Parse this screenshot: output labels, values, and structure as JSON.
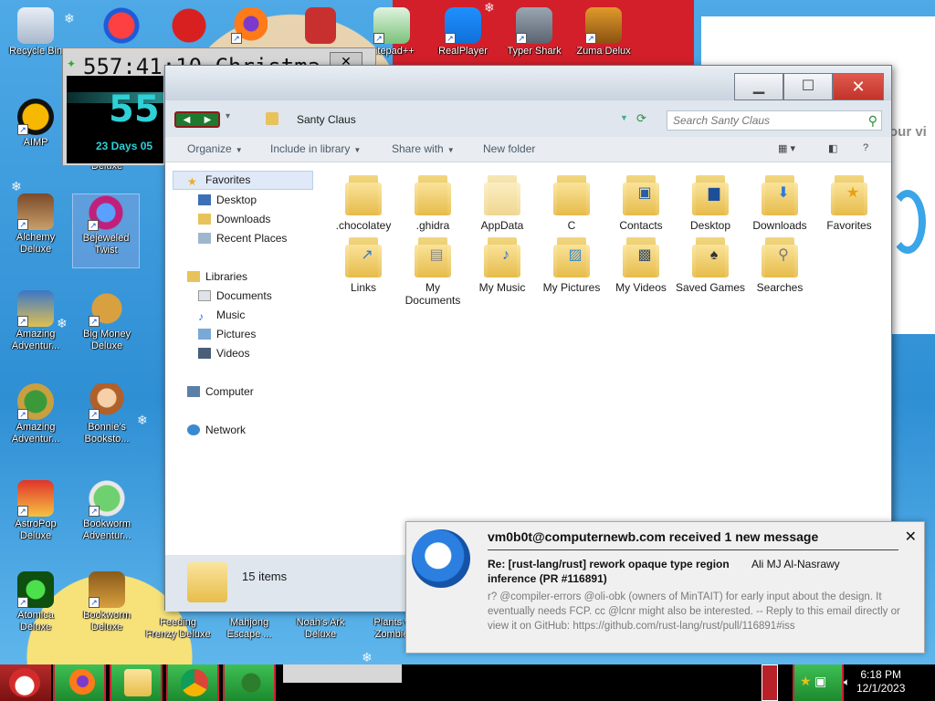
{
  "desktop": {
    "icons": [
      {
        "label": "Recycle Bin",
        "icon": "recycle-bin-icon"
      },
      {
        "label": "AIMP",
        "icon": "aimp-icon"
      },
      {
        "label": "Alchemy Deluxe",
        "icon": "alchemy-icon"
      },
      {
        "label": "Amazing Adventur...",
        "icon": "amazing-adventures-icon"
      },
      {
        "label": "Amazing Adventur...",
        "icon": "amazing-adventures-2-icon"
      },
      {
        "label": "AstroPop Deluxe",
        "icon": "astropop-icon"
      },
      {
        "label": "Atomica Deluxe",
        "icon": "atomica-icon"
      },
      {
        "label": "Deluxe",
        "icon": "app-icon"
      },
      {
        "label": "Bejeweled Twist",
        "icon": "bejeweled-icon"
      },
      {
        "label": "Big Money Deluxe",
        "icon": "big-money-icon"
      },
      {
        "label": "Bonnie's Booksto...",
        "icon": "bonnies-bookstore-icon"
      },
      {
        "label": "Bookworm Adventur...",
        "icon": "bookworm-icon"
      },
      {
        "label": "Bookworm Deluxe",
        "icon": "bookworm-deluxe-icon"
      },
      {
        "label": "Feeding Frenzy Deluxe",
        "icon": "feeding-frenzy-icon"
      },
      {
        "label": "Mahjong Escape ...",
        "icon": "mahjong-icon"
      },
      {
        "label": "Noah's Ark Deluxe",
        "icon": "noahs-ark-icon"
      },
      {
        "label": "Plants v Zombie",
        "icon": "plants-zombies-icon"
      },
      {
        "label": "Firefox",
        "icon": "firefox-icon"
      },
      {
        "label": "",
        "icon": "shrine-icon"
      },
      {
        "label": "...tepad++",
        "icon": "notepadpp-icon"
      },
      {
        "label": "RealPlayer",
        "icon": "realplayer-icon"
      },
      {
        "label": "Typer Shark",
        "icon": "typer-shark-icon"
      },
      {
        "label": "Zuma Delux",
        "icon": "zuma-icon"
      }
    ],
    "clock": {
      "countdown": "557:41:10",
      "overlay_text": "Christma",
      "big_value": "55",
      "days_text": "23 Days 05"
    },
    "panel_peek": "our vi"
  },
  "explorer": {
    "title": "Santy Claus",
    "search_placeholder": "Search Santy Claus",
    "toolbar": {
      "organize": "Organize",
      "include": "Include in library",
      "share": "Share with",
      "new_folder": "New folder"
    },
    "nav": {
      "favorites": "Favorites",
      "desktop": "Desktop",
      "downloads": "Downloads",
      "recent": "Recent Places",
      "libraries": "Libraries",
      "documents": "Documents",
      "music": "Music",
      "pictures": "Pictures",
      "videos": "Videos",
      "computer": "Computer",
      "network": "Network"
    },
    "items": [
      {
        "name": ".chocolatey"
      },
      {
        "name": ".ghidra"
      },
      {
        "name": "AppData"
      },
      {
        "name": "C"
      },
      {
        "name": "Contacts"
      },
      {
        "name": "Desktop"
      },
      {
        "name": "Downloads"
      },
      {
        "name": "Favorites"
      },
      {
        "name": "Links"
      },
      {
        "name": "My Documents"
      },
      {
        "name": "My Music"
      },
      {
        "name": "My Pictures"
      },
      {
        "name": "My Videos"
      },
      {
        "name": "Saved Games"
      },
      {
        "name": "Searches"
      }
    ],
    "status": "15 items"
  },
  "notification": {
    "title": "vm0b0t@computernewb.com received 1 new message",
    "subject": "Re: [rust-lang/rust] rework opaque type region inference (PR #116891)",
    "from": "Ali MJ Al-Nasrawy",
    "body": "r? @compiler-errors @oli-obk (owners of MinTAIT) for early input about the design. It eventually needs FCP. cc @lcnr might also be interested. -- Reply to this email directly or view it on GitHub: https://github.com/rust-lang/rust/pull/116891#iss"
  },
  "taskbar": {
    "time": "6:18 PM",
    "date": "12/1/2023"
  }
}
